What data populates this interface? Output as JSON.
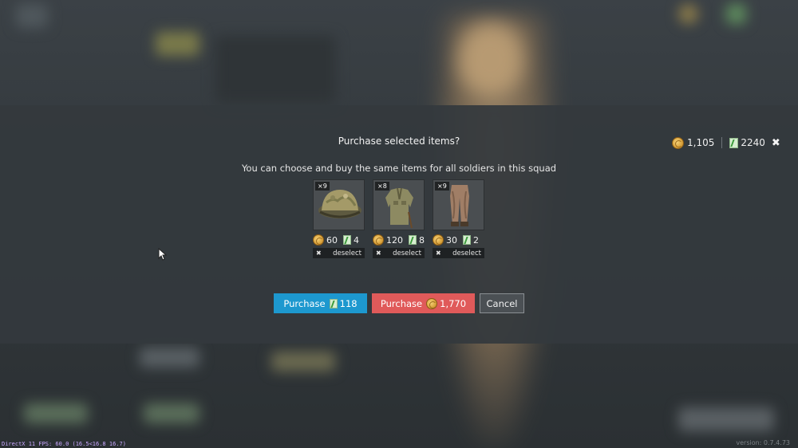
{
  "dialog": {
    "title": "Purchase selected items?",
    "subtitle": "You can choose and buy the same items for all soldiers in this squad"
  },
  "wallet": {
    "silver": "1,105",
    "tickets": "2240"
  },
  "items": [
    {
      "qty": "×9",
      "name": "helmet",
      "silver": "60",
      "tickets": "4",
      "deselect": "deselect"
    },
    {
      "qty": "×8",
      "name": "tunic",
      "silver": "120",
      "tickets": "8",
      "deselect": "deselect"
    },
    {
      "qty": "×9",
      "name": "trousers",
      "silver": "30",
      "tickets": "2",
      "deselect": "deselect"
    }
  ],
  "buttons": {
    "purchase_tickets_label": "Purchase",
    "purchase_tickets_amount": "118",
    "purchase_silver_label": "Purchase",
    "purchase_silver_amount": "1,770",
    "cancel_label": "Cancel"
  },
  "footer": {
    "fps": "DirectX 11 FPS: 60.0 (16.5<16.8 16.7)",
    "version": "version: 0.7.4.73"
  },
  "colors": {
    "purchase_blue": "#1d98cf",
    "purchase_red": "#e05a5a",
    "modal_bg": "#34393d"
  }
}
